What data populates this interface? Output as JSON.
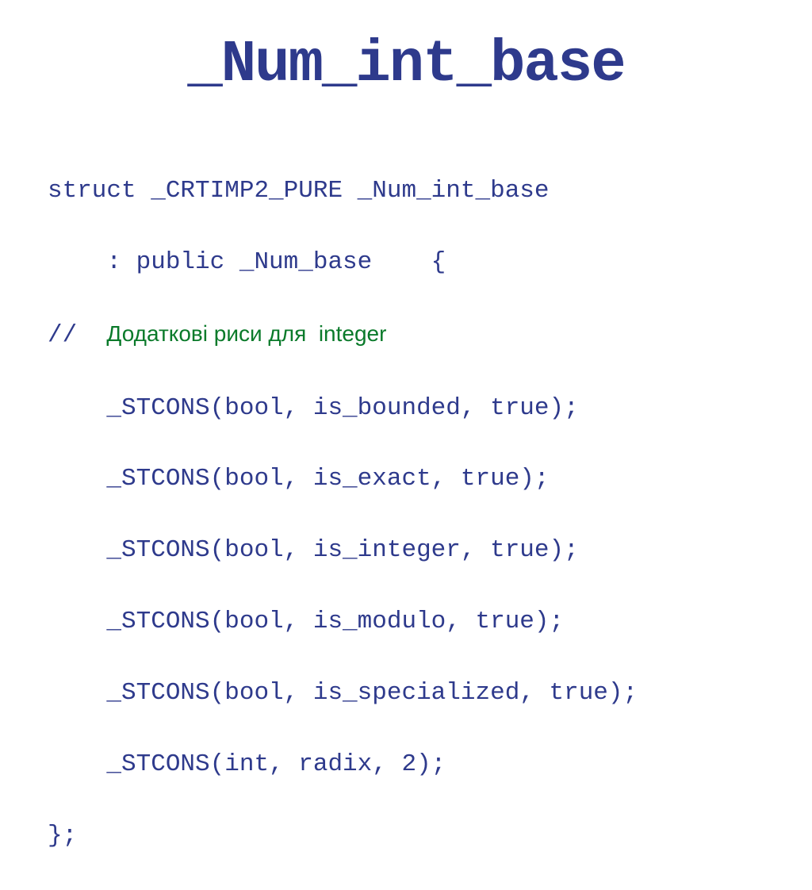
{
  "slide": {
    "title": "_Num_int_base"
  },
  "code": {
    "line1": "struct _CRTIMP2_PURE _Num_int_base",
    "line2": "    : public _Num_base    {",
    "comment_prefix": "//  ",
    "comment_text": "Додаткові риси для  integer",
    "line3": "    _STCONS(bool, is_bounded, true);",
    "line4": "    _STCONS(bool, is_exact, true);",
    "line5": "    _STCONS(bool, is_integer, true);",
    "line6": "    _STCONS(bool, is_modulo, true);",
    "line7": "    _STCONS(bool, is_specialized, true);",
    "line8": "    _STCONS(int, radix, 2);",
    "line9": "};"
  }
}
